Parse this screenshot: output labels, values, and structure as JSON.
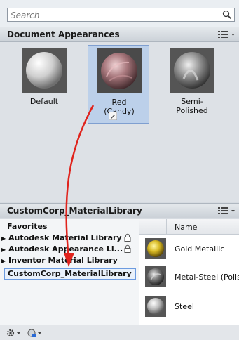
{
  "search": {
    "placeholder": "Search"
  },
  "document_panel": {
    "title": "Document Appearances",
    "tiles": [
      {
        "label": "Default"
      },
      {
        "label_line1": "Red",
        "label_line2": "(Candy)"
      },
      {
        "label_line1": "Semi-",
        "label_line2": "Polished"
      }
    ]
  },
  "library_panel": {
    "title": "CustomCorp_MaterialLibrary",
    "tree": [
      {
        "label": "Favorites"
      },
      {
        "label": "Autodesk Material Library"
      },
      {
        "label": "Autodesk Appearance Li..."
      },
      {
        "label": "Inventor Material Library"
      },
      {
        "label": "CustomCorp_MaterialLibrary"
      }
    ],
    "column_header": "Name",
    "materials": [
      {
        "name": "Gold Metallic"
      },
      {
        "name": "Metal-Steel (Polis"
      },
      {
        "name": "Steel"
      }
    ]
  },
  "colors": {
    "accent_arrow": "#e0231c",
    "selection": "#bcd0ea"
  }
}
